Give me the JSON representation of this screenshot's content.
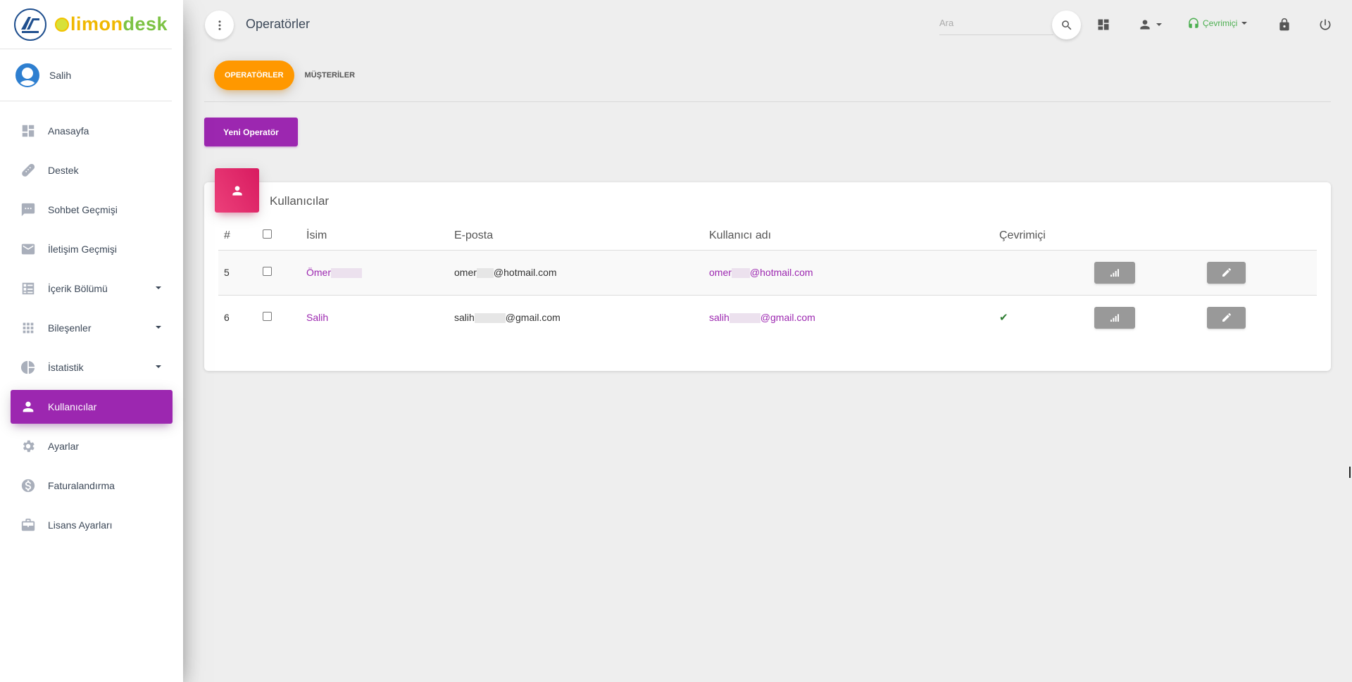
{
  "brand": {
    "name_part1": "limon",
    "name_part2": "desk"
  },
  "user": {
    "name": "Salih"
  },
  "sidebar": {
    "items": [
      {
        "label": "Anasayfa",
        "icon": "dashboard-icon",
        "caret": false,
        "active": false
      },
      {
        "label": "Destek",
        "icon": "support-icon",
        "caret": false,
        "active": false
      },
      {
        "label": "Sohbet Geçmişi",
        "icon": "chat-icon",
        "caret": false,
        "active": false
      },
      {
        "label": "İletişim Geçmişi",
        "icon": "mail-icon",
        "caret": false,
        "active": false
      },
      {
        "label": "İçerik Bölümü",
        "icon": "content-icon",
        "caret": true,
        "active": false
      },
      {
        "label": "Bileşenler",
        "icon": "apps-icon",
        "caret": true,
        "active": false
      },
      {
        "label": "İstatistik",
        "icon": "pie-chart-icon",
        "caret": true,
        "active": false
      },
      {
        "label": "Kullanıcılar",
        "icon": "person-icon",
        "caret": false,
        "active": true
      },
      {
        "label": "Ayarlar",
        "icon": "gear-icon",
        "caret": false,
        "active": false
      },
      {
        "label": "Faturalandırma",
        "icon": "dollar-icon",
        "caret": false,
        "active": false
      },
      {
        "label": "Lisans Ayarları",
        "icon": "briefcase-icon",
        "caret": false,
        "active": false
      }
    ]
  },
  "header": {
    "title": "Operatörler",
    "search_placeholder": "Ara",
    "status_label": "Çevrimiçi"
  },
  "tabs": [
    {
      "label": "OPERATÖRLER",
      "active": true
    },
    {
      "label": "MÜŞTERİLER",
      "active": false
    }
  ],
  "actions": {
    "new_operator": "Yeni Operatör"
  },
  "card": {
    "title": "Kullanıcılar",
    "columns": [
      "#",
      "",
      "İsim",
      "E-posta",
      "Kullanıcı adı",
      "Çevrimiçi"
    ],
    "rows": [
      {
        "id": "5",
        "name": "Ömer",
        "email_prefix": "omer",
        "email_suffix": "@hotmail.com",
        "username_prefix": "omer",
        "username_suffix": "@hotmail.com",
        "online": false
      },
      {
        "id": "6",
        "name": "Salih",
        "email_prefix": "salih",
        "email_suffix": "@gmail.com",
        "username_prefix": "salih",
        "username_suffix": "@gmail.com",
        "online": true
      }
    ]
  },
  "colors": {
    "primary": "#9c27b0",
    "accent": "#ff9800",
    "card_icon": "#e91e63",
    "online": "#4caf50"
  }
}
